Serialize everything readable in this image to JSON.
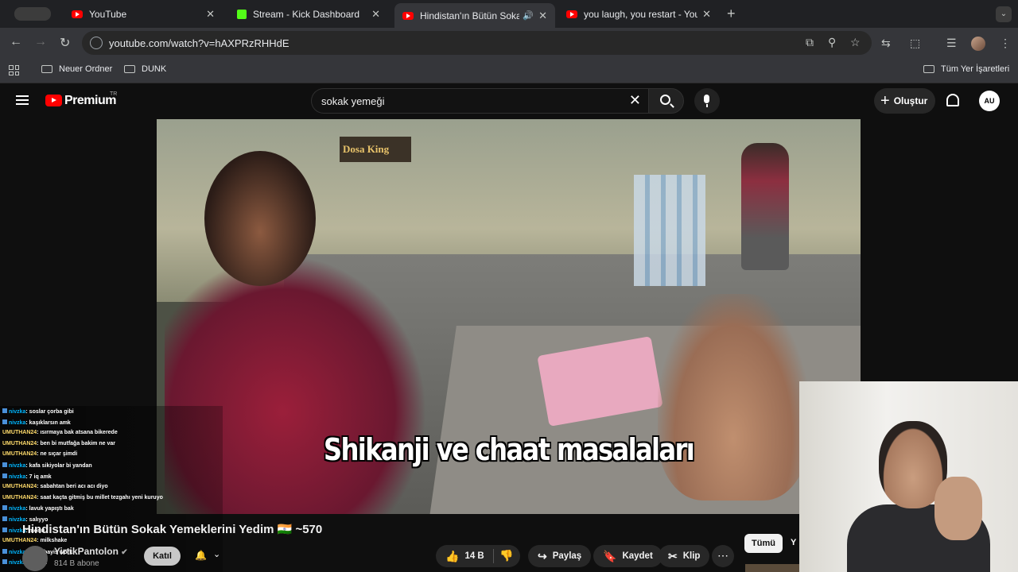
{
  "browser": {
    "tabs": [
      {
        "title": "YouTube",
        "favicon": "youtube-icon"
      },
      {
        "title": "Stream - Kick Dashboard",
        "favicon": "kick-icon"
      },
      {
        "title": "Hindistan'ın Bütün Sokak",
        "favicon": "youtube-icon",
        "active": true,
        "audio": true
      },
      {
        "title": "you laugh, you restart - YouTu",
        "favicon": "youtube-icon"
      }
    ],
    "url": "youtube.com/watch?v=hAXPRzRHHdE",
    "bookmarks": [
      "Neuer Ordner",
      "DUNK"
    ],
    "all_bookmarks": "Tüm Yer İşaretleri"
  },
  "youtube": {
    "brand": "Premium",
    "region": "TR",
    "search_value": "sokak yemeği",
    "create_label": "Oluştur",
    "avatar_text": "AU"
  },
  "video": {
    "subtitle": "Shikanji ve chaat masalaları",
    "sign_text": "Dosa King",
    "title": "Hindistan'ın Bütün Sokak Yemeklerini Yedim 🇮🇳 ~570",
    "channel": "YirtikPantolon",
    "subscribers": "814 B abone",
    "join": "Katıl",
    "likes": "14 B",
    "share": "Paylaş",
    "save": "Kaydet",
    "clip": "Klip",
    "chip_all": "Tümü",
    "chip_next": "Y"
  },
  "chat": [
    {
      "user": "nivzka",
      "msg": ": soslar çorba gibi"
    },
    {
      "user": "nivzka",
      "msg": ": kaşıklarsın amk"
    },
    {
      "user": "UMUTHAN24",
      "msg": ": ısırmaya bak atsana bikerede"
    },
    {
      "user": "UMUTHAN24",
      "msg": ": ben bi mutfağa bakim ne var"
    },
    {
      "user": "UMUTHAN24",
      "msg": ": ne sıçar şimdi"
    },
    {
      "user": "nivzka",
      "msg": ": kafa sikiyolar bi yandan"
    },
    {
      "user": "nivzka",
      "msg": ": 7 iq amk"
    },
    {
      "user": "UMUTHAN24",
      "msg": ": sabahtan beri acı acı diyo"
    },
    {
      "user": "UMUTHAN24",
      "msg": ": saat kaçta gitmiş bu millet tezgahı yeni kuruyo"
    },
    {
      "user": "nivzka",
      "msg": ": lavuk yapıştı bak"
    },
    {
      "user": "nivzka",
      "msg": ": salıyyo"
    },
    {
      "user": "nivzka",
      "msg": ": morıu"
    },
    {
      "user": "UMUTHAN24",
      "msg": ": milkshake"
    },
    {
      "user": "nivzka",
      "msg": ": work bayis work"
    },
    {
      "user": "nivzka",
      "msg": ": içilir la"
    }
  ]
}
